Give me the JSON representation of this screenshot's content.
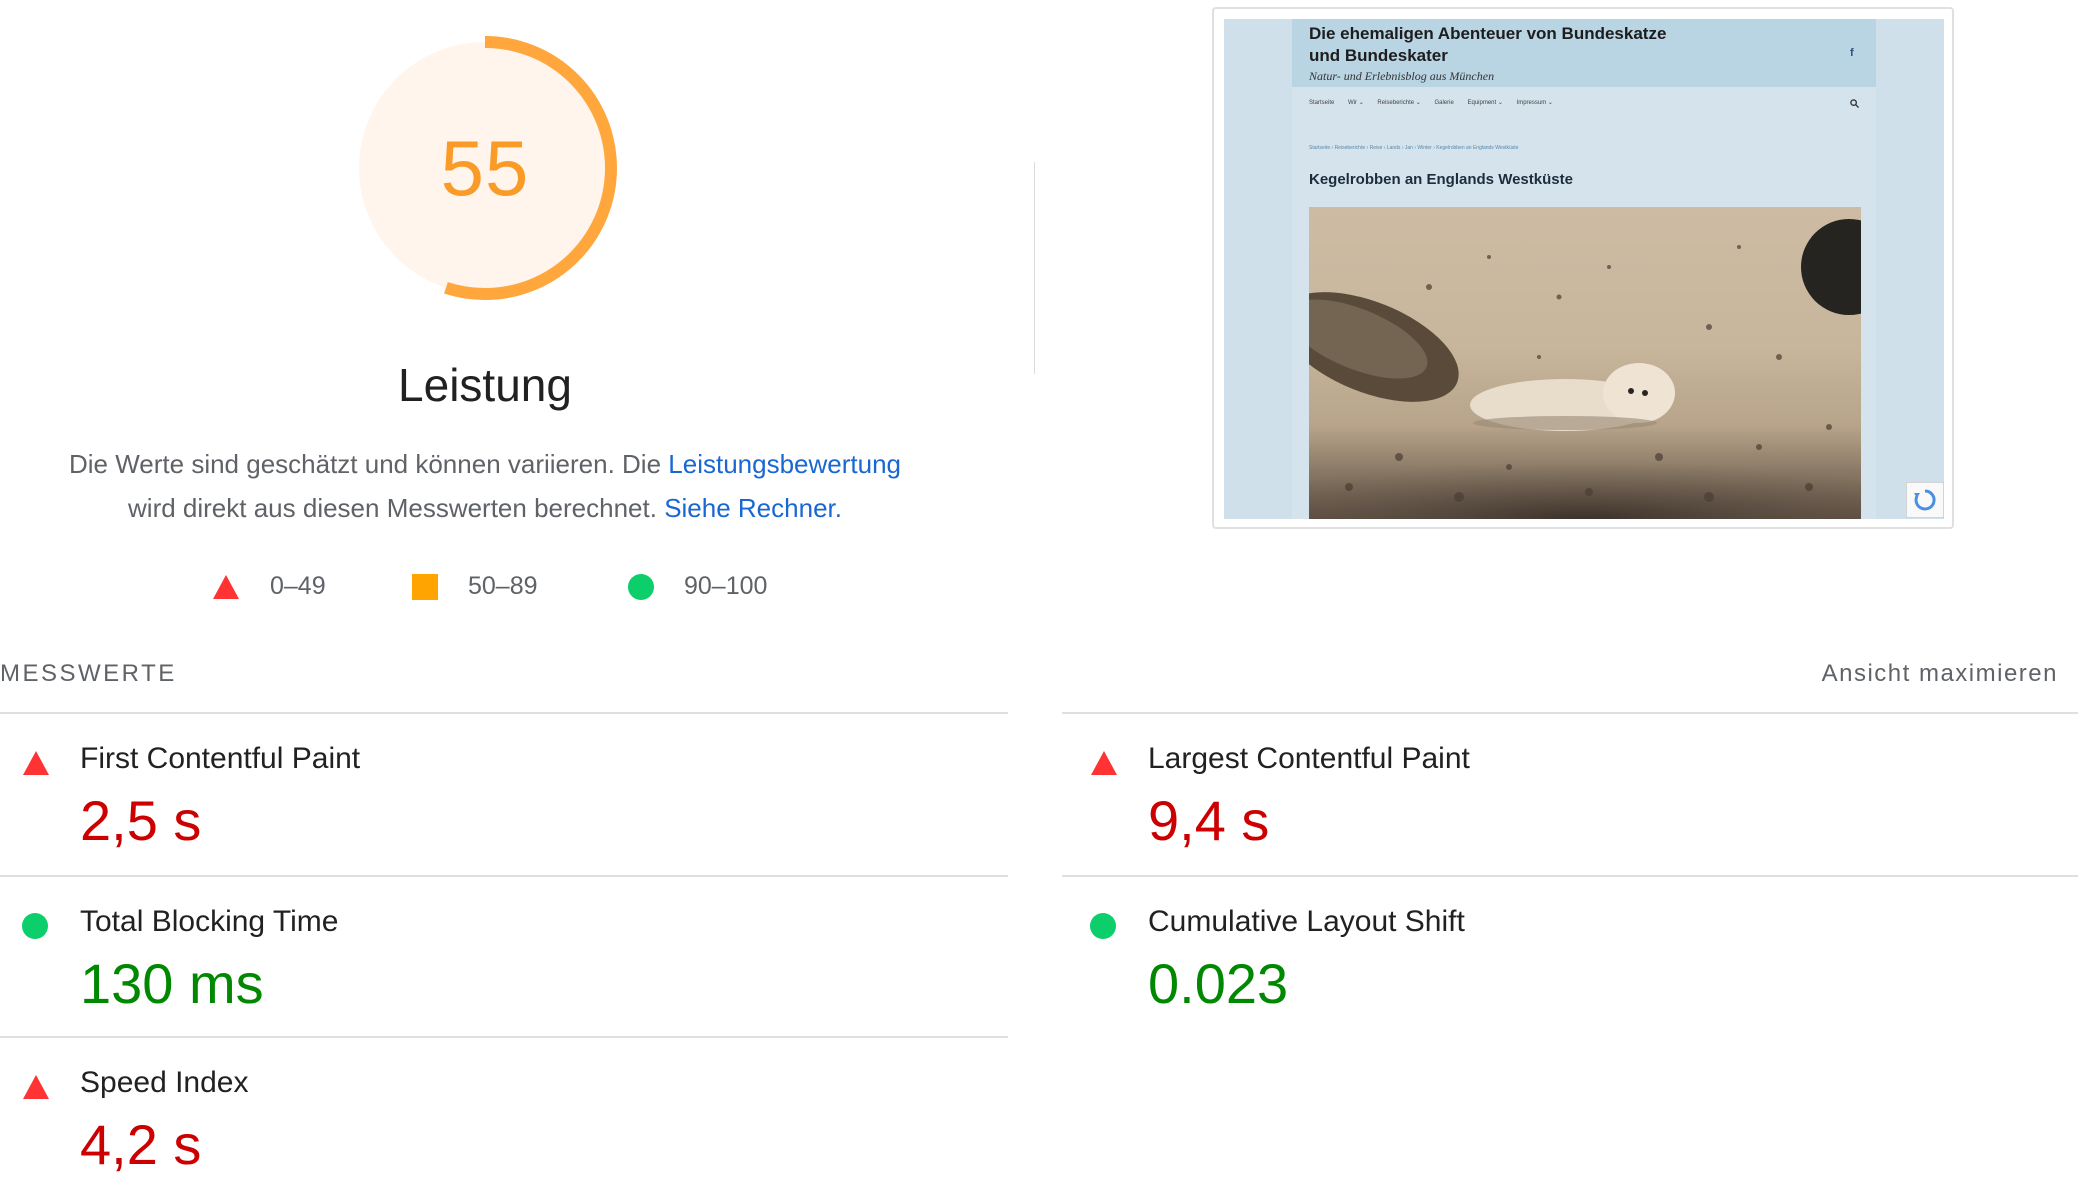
{
  "gauge": {
    "score": "55",
    "fraction": 0.55,
    "ring_color": "#ffa63c",
    "fill_color": "#fff5ec"
  },
  "category": {
    "title": "Leistung",
    "desc_prefix": "Die Werte sind geschätzt und können variieren. Die",
    "desc_link1": "Leistungsbewertung",
    "desc_middle": "wird direkt aus diesen Messwerten berechnet.",
    "desc_link2": "Siehe Rechner."
  },
  "legend": [
    {
      "icon": "triangle-icon",
      "range": "0–49",
      "color": "#ff3333"
    },
    {
      "icon": "square-icon",
      "range": "50–89",
      "color": "#ffa400"
    },
    {
      "icon": "circle-icon",
      "range": "90–100",
      "color": "#0cce6b"
    }
  ],
  "screenshot": {
    "site_title": "Die ehemaligen Abenteuer von Bundeskatze und Bundeskater",
    "tagline": "Natur- und Erlebnisblog aus München",
    "nav": [
      "Startseite",
      "Wir ⌄",
      "Reiseberichte ⌄",
      "Galerie",
      "Equipment ⌄",
      "Impressum ⌄"
    ],
    "breadcrumbs": "Startseite › Reiseberichte › Reise › Lands › Jan › Winter › Kegelrobben an Englands Westküste",
    "article_title": "Kegelrobben an Englands Westküste"
  },
  "metrics_section": {
    "label": "MESSWERTE",
    "toggle": "Ansicht maximieren"
  },
  "metrics": [
    {
      "name": "First Contentful Paint",
      "value": "2,5 s",
      "status": "bad"
    },
    {
      "name": "Largest Contentful Paint",
      "value": "9,4 s",
      "status": "bad"
    },
    {
      "name": "Total Blocking Time",
      "value": "130 ms",
      "status": "good"
    },
    {
      "name": "Cumulative Layout Shift",
      "value": "0.023",
      "status": "good"
    },
    {
      "name": "Speed Index",
      "value": "4,2 s",
      "status": "bad"
    }
  ],
  "colors": {
    "bad_text": "#cc0000",
    "good_text": "#008800",
    "bad_icon": "#ff3333",
    "good_icon": "#0cce6b",
    "link": "#1967d2"
  }
}
